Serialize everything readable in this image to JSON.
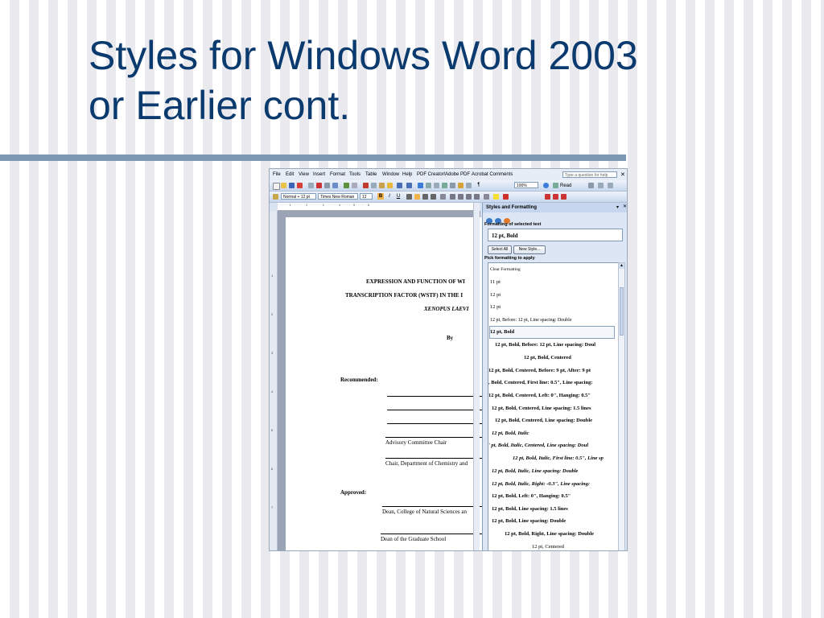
{
  "slide": {
    "title_line1": "Styles for Windows Word 2003",
    "title_line2": "or Earlier cont."
  },
  "word": {
    "menu": [
      "File",
      "Edit",
      "View",
      "Insert",
      "Format",
      "Tools",
      "Table",
      "Window",
      "Help",
      "PDF Creator!",
      "Adobe PDF",
      "Acrobat Comments"
    ],
    "help_placeholder": "Type a question for help",
    "toolbar": {
      "zoom": "100%",
      "read_label": "Read",
      "style_value": "Normal + 12 pt",
      "font_value": "Times New Roman",
      "size_value": "12",
      "bold": "B",
      "italic": "I",
      "underline": "U"
    },
    "document": {
      "line1": "EXPRESSION AND FUNCTION OF WI",
      "line2": "TRANSCRIPTION FACTOR (WSTF) IN THE I",
      "line3": "XENOPUS LAEVI",
      "by": "By",
      "recommended": "Recommended:",
      "advisory": "Advisory Committee Chair",
      "chair": "Chair, Department of Chemistry and",
      "approved": "Approved:",
      "dean1": "Dean, College of Natural Sciences an",
      "dean2": "Dean of the Graduate School"
    },
    "pane": {
      "title": "Styles and Formatting",
      "formatting_label": "Formatting of selected text",
      "selected": "12 pt, Bold",
      "select_all": "Select All",
      "new_style": "New Style...",
      "pick_label": "Pick formatting to apply",
      "styles": [
        "Clear Formatting",
        "11 pt",
        "12 pt",
        "12 pt",
        "12 pt, Before:  12 pt, Line spacing:  Double",
        "12 pt, Bold",
        "12 pt, Bold, Before:   12 pt, Line spacing:  Doul",
        "12 pt, Bold, Centered",
        "12 pt, Bold, Centered, Before:  9 pt, After:  9 pt",
        ", Bold, Centered, First line:  0.5\", Line spacing:",
        "12 pt, Bold, Centered, Left:  0\", Hanging:  0.5\"",
        "12 pt, Bold, Centered, Line spacing:  1.5 lines",
        "12 pt, Bold, Centered, Line spacing:  Double",
        "12 pt, Bold, Italic",
        "' pt, Bold, Italic, Centered, Line spacing:  Doul",
        "12 pt, Bold, Italic, First line:  0.5\", Line sp",
        "12 pt, Bold, Italic, Line spacing:  Double",
        "12 pt, Bold, Italic, Right:  -0.3\", Line spacing:",
        "12 pt, Bold, Left:  0\", Hanging:  0.5\"",
        "12 pt, Bold, Line spacing:  1.5 lines",
        "12 pt, Bold, Line spacing:  Double",
        "12 pt, Bold, Right, Line spacing:  Double",
        "12 pt, Centered"
      ]
    }
  }
}
